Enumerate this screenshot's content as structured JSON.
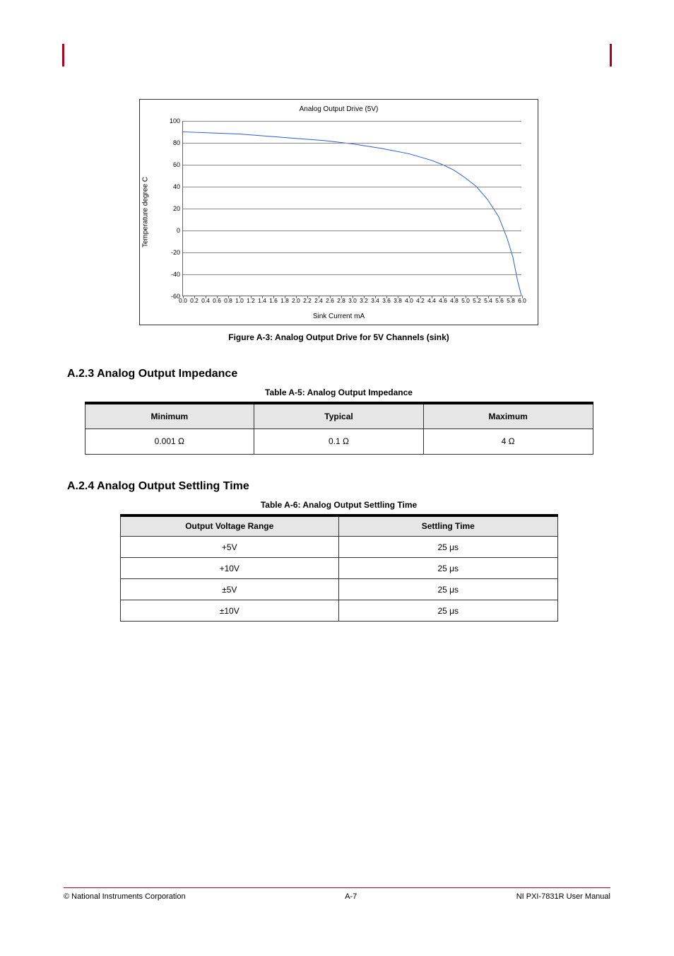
{
  "page_marks": {
    "left": "",
    "right": ""
  },
  "chart_data": {
    "type": "line",
    "title": "Analog Output Drive (5V)",
    "xlabel": "Sink Current  mA",
    "ylabel": "Temperature  degree C",
    "ylim": [
      -60,
      100
    ],
    "xlim": [
      0,
      6
    ],
    "yticks": [
      -60,
      -40,
      -20,
      0,
      20,
      40,
      60,
      80,
      100
    ],
    "xticks": [
      0.0,
      0.2,
      0.4,
      0.6,
      0.8,
      1.0,
      1.2,
      1.4,
      1.6,
      1.8,
      2.0,
      2.2,
      2.4,
      2.6,
      2.8,
      3.0,
      3.2,
      3.4,
      3.6,
      3.8,
      4.0,
      4.2,
      4.4,
      4.6,
      4.8,
      5.0,
      5.2,
      5.4,
      5.6,
      5.8,
      6.0
    ],
    "series": [
      {
        "name": "5V",
        "x": [
          0.0,
          0.5,
          1.0,
          1.5,
          2.0,
          2.5,
          3.0,
          3.5,
          4.0,
          4.2,
          4.4,
          4.6,
          4.8,
          5.0,
          5.2,
          5.4,
          5.6,
          5.75,
          5.85,
          5.9,
          5.93,
          5.96,
          5.98,
          6.0
        ],
        "y": [
          90,
          89,
          88,
          86,
          84,
          82,
          79,
          75,
          70,
          67,
          64,
          60,
          55,
          48,
          40,
          28,
          12,
          -8,
          -25,
          -38,
          -46,
          -52,
          -56,
          -60
        ]
      }
    ]
  },
  "figure_caption": "Figure A-3: Analog Output Drive for 5V Channels (sink)",
  "sections": {
    "ao_impedance": {
      "title": "A.2.3   Analog Output Impedance",
      "table_caption": "Table  A-5: Analog Output Impedance",
      "headers": [
        "Minimum",
        "Typical",
        "Maximum"
      ],
      "row": [
        "0.001 Ω",
        "0.1 Ω",
        "4 Ω"
      ]
    },
    "ao_settling": {
      "title": "A.2.4   Analog Output Settling Time",
      "table_caption": "Table  A-6: Analog Output Settling Time",
      "headers": [
        "Output Voltage Range",
        "Settling Time"
      ],
      "rows": [
        [
          "+5V",
          "25 μs"
        ],
        [
          "+10V",
          "25 μs"
        ],
        [
          "±5V",
          "25 μs"
        ],
        [
          "±10V",
          "25 μs"
        ]
      ]
    }
  },
  "footer": {
    "left": "© National Instruments Corporation",
    "center": "A-7",
    "right": "NI PXI-7831R User Manual"
  }
}
